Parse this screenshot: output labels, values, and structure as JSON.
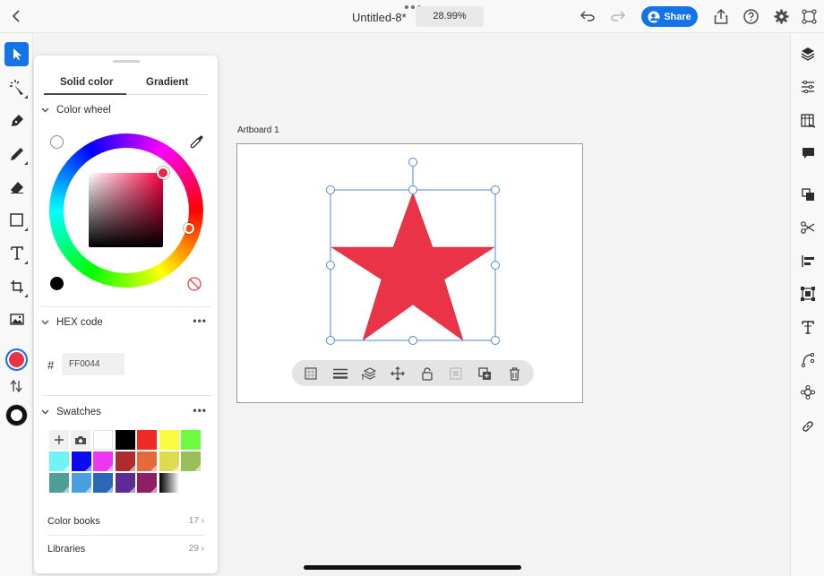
{
  "topbar": {
    "title": "Untitled-8*",
    "zoom": "28.99%",
    "share_label": "Share"
  },
  "colors": {
    "accent": "#1473e6",
    "selected_fill": "#ea3346",
    "stroke": "#000000",
    "star": "#ea3346"
  },
  "color_panel": {
    "tabs": [
      {
        "label": "Solid color",
        "active": true
      },
      {
        "label": "Gradient",
        "active": false
      }
    ],
    "wheel_section_label": "Color wheel",
    "hex_section_label": "HEX code",
    "hex_prefix": "#",
    "hex_value": "FF0044",
    "swatches_section_label": "Swatches",
    "swatches": [
      "#ffffff",
      "#000000",
      "#ed2b24",
      "#fbfb43",
      "#6efb3f",
      "#70f3f7",
      "#0b0df0",
      "#ec37ee",
      "#ad2d2f",
      "#e6693a",
      "#dcdc4e",
      "#98c05a",
      "#4f9e98",
      "#4aa0de",
      "#2c67b4",
      "#5d2b93",
      "#901e62",
      "gradient"
    ],
    "color_books": {
      "label": "Color books",
      "count": "17"
    },
    "libraries": {
      "label": "Libraries",
      "count": "29"
    }
  },
  "canvas": {
    "artboard_label": "Artboard 1"
  },
  "left_tools": [
    "select-icon",
    "smart-select-icon",
    "pen-icon",
    "pencil-icon",
    "eraser-icon",
    "rectangle-icon",
    "text-icon",
    "crop-icon",
    "image-icon"
  ],
  "right_tools": [
    "layers-icon",
    "properties-icon",
    "assets-icon",
    "comments-icon",
    "arrange-icon",
    "path-operations-icon",
    "align-icon",
    "transform-icon",
    "text-properties-icon",
    "path-icon",
    "repeat-icon",
    "links-icon"
  ],
  "context_actions": [
    "transparency-icon",
    "stroke-weight-icon",
    "arrange-icon",
    "move-icon",
    "unlock-icon",
    "group-icon",
    "duplicate-icon",
    "delete-icon"
  ]
}
